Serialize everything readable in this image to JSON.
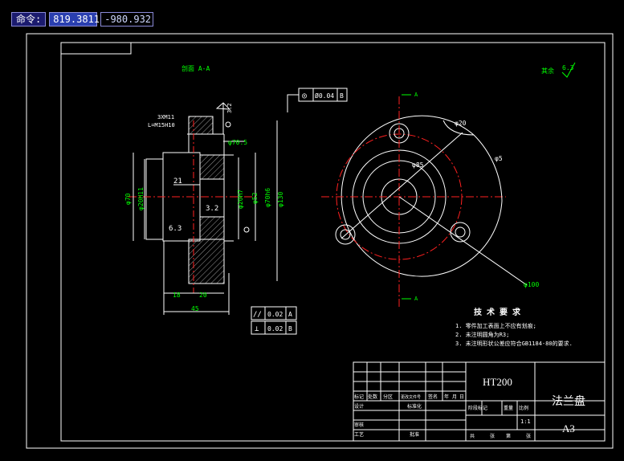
{
  "command": {
    "label": "命令:",
    "x_value": "819.3811",
    "y_value": "-980.932"
  },
  "drawing": {
    "section_title": "剖面 A-A",
    "roughness_note": "其余",
    "roughness_value": "6.3",
    "left_view": {
      "thread_top": "3XM11",
      "thread_bottom": "L=M15H10",
      "dims": [
        "21",
        "3.2",
        "6.3",
        "φ70",
        "φ20H11",
        "φ20H7",
        "φ52",
        "φ70h6",
        "φ130",
        "φ70.5",
        "18",
        "20",
        "45"
      ],
      "surface": "3.2"
    },
    "tolerance_top": {
      "symbol": "◎",
      "value": "Ø0.04",
      "datum": "B"
    },
    "tolerance_bottom": [
      {
        "symbol": "//",
        "value": "0.02",
        "datum": "A"
      },
      {
        "symbol": "⊥",
        "value": "0.02",
        "datum": "B"
      }
    ],
    "right_view": {
      "dims": [
        "φ20",
        "φ5",
        "φ85",
        "φ100"
      ],
      "section_mark": "A"
    },
    "notes": {
      "title": "技 术 要 求",
      "items": [
        "1. 零件加工表面上不应有划痕;",
        "2. 未注明圆角为R3;",
        "3. 未注明形状公差应符合GB1184-80的要求."
      ]
    },
    "title_block": {
      "material": "HT200",
      "part_name": "法兰盘",
      "sheet": "A3",
      "headers": [
        "标记",
        "处数",
        "分区",
        "更改文件号",
        "签名",
        "年",
        "月",
        "日"
      ],
      "roles": [
        "设计",
        "标准化",
        "审核",
        "工艺",
        "批准"
      ],
      "extra": [
        "阶段标记",
        "重量",
        "比例",
        "1:1",
        "共",
        "张",
        "第",
        "张"
      ]
    }
  }
}
